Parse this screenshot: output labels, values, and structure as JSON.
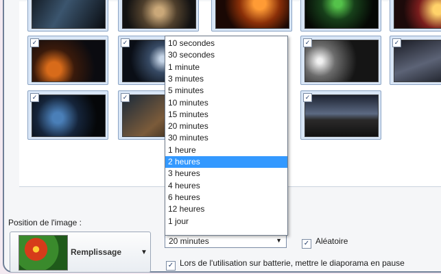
{
  "interval_dropdown": {
    "options": [
      "10 secondes",
      "30 secondes",
      "1 minute",
      "3 minutes",
      "5 minutes",
      "10 minutes",
      "15 minutes",
      "20 minutes",
      "30 minutes",
      "1 heure",
      "2 heures",
      "3 heures",
      "4 heures",
      "6 heures",
      "12 heures",
      "1 jour"
    ],
    "highlighted": "2 heures",
    "selected_value": "20 minutes"
  },
  "position": {
    "label": "Position de l'image :",
    "value": "Remplissage"
  },
  "options": {
    "shuffle_label": "Aléatoire",
    "shuffle_checked": true,
    "battery_label": "Lors de l'utilisation sur batterie, mettre le diaporama en pause",
    "battery_checked": true
  },
  "thumbnails": {
    "checked_glyph": "✓"
  }
}
